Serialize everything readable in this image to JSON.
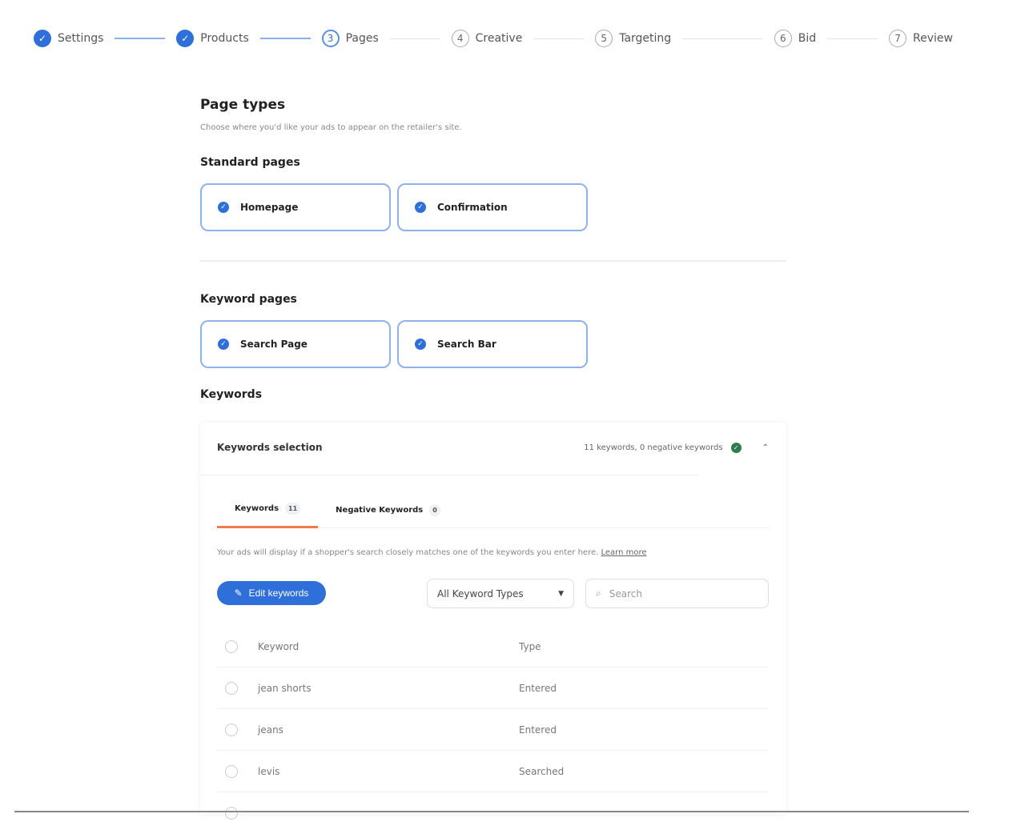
{
  "stepper": [
    {
      "n": "1",
      "label": "Settings",
      "state": "done"
    },
    {
      "n": "2",
      "label": "Products",
      "state": "done"
    },
    {
      "n": "3",
      "label": "Pages",
      "state": "current"
    },
    {
      "n": "4",
      "label": "Creative",
      "state": "todo"
    },
    {
      "n": "5",
      "label": "Targeting",
      "state": "todo"
    },
    {
      "n": "6",
      "label": "Bid",
      "state": "todo"
    },
    {
      "n": "7",
      "label": "Review",
      "state": "todo"
    }
  ],
  "page": {
    "title": "Page types",
    "subtitle": "Choose where you'd like your ads to appear on the retailer's site.",
    "standard_title": "Standard pages",
    "standard": [
      "Homepage",
      "Confirmation"
    ],
    "keyword_pages_title": "Keyword pages",
    "keyword_pages": [
      "Search Page",
      "Search Bar"
    ],
    "keywords_title": "Keywords"
  },
  "panel": {
    "title": "Keywords selection",
    "summary": "11 keywords, 0 negative keywords",
    "tabs": [
      {
        "label": "Keywords",
        "count": "11"
      },
      {
        "label": "Negative Keywords",
        "count": "0"
      }
    ],
    "info": "Your ads will display if a shopper's search closely matches one of the keywords you enter here.",
    "learn_more": "Learn more",
    "edit_button": "Edit keywords",
    "filter": "All Keyword Types",
    "search_placeholder": "Search",
    "headers": {
      "keyword": "Keyword",
      "type": "Type"
    },
    "rows": [
      {
        "keyword": "jean shorts",
        "type": "Entered"
      },
      {
        "keyword": "jeans",
        "type": "Entered"
      },
      {
        "keyword": "levis",
        "type": "Searched"
      }
    ]
  },
  "colors": {
    "accent": "#2f6fd9",
    "tab_underline": "#f07a4c",
    "success": "#2e7d4f"
  }
}
